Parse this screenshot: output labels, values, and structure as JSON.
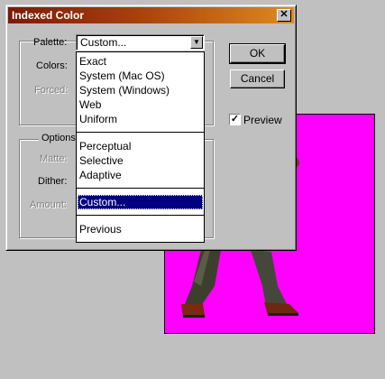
{
  "dialog": {
    "title": "Indexed Color",
    "close_glyph": "✕",
    "palette_label": "Palette:",
    "colors_label": "Colors:",
    "forced_label": "Forced:",
    "options_group": "Options",
    "matte_label": "Matte:",
    "dither_label": "Dither:",
    "amount_label": "Amount:",
    "palette_value": "Custom...",
    "ok_label": "OK",
    "cancel_label": "Cancel",
    "preview_label": "Preview",
    "preview_checked": true,
    "check_glyph": "✓",
    "arrow_glyph": "▼"
  },
  "dropdown": {
    "groups": [
      [
        "Exact",
        "System (Mac OS)",
        "System (Windows)",
        "Web",
        "Uniform"
      ],
      [
        "Perceptual",
        "Selective",
        "Adaptive"
      ],
      [
        "Custom..."
      ],
      [
        "Previous"
      ]
    ],
    "selected": "Custom..."
  },
  "canvas": {
    "background": "#ff00ff"
  }
}
